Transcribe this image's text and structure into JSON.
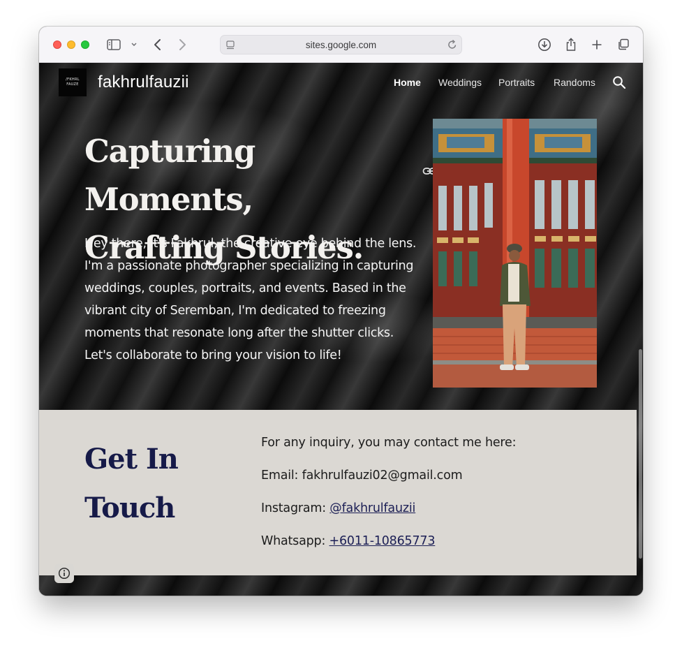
{
  "browser": {
    "url": "sites.google.com"
  },
  "site": {
    "logo_lines": [
      "/FKHRL",
      "FAUZE"
    ],
    "title": "fakhrulfauzii",
    "nav": [
      {
        "label": "Home",
        "active": true
      },
      {
        "label": "Weddings",
        "active": false
      },
      {
        "label": "Portraits",
        "active": false
      },
      {
        "label": "Randoms",
        "active": false
      }
    ]
  },
  "hero": {
    "title_line1": "Capturing Moments,",
    "title_line2": "Crafting Stories.",
    "body": "Hey there, it's Fakhrul, the creative eye behind the lens. I'm a passionate photographer specializing in capturing weddings, couples, portraits, and events. Based in the vibrant city of Seremban, I'm dedicated to freezing moments that resonate long after the shutter clicks. Let's collaborate to bring your vision to life!"
  },
  "contact": {
    "title_line1": "Get In",
    "title_line2": "Touch",
    "intro": "For any inquiry, you may contact me here:",
    "email_label": "Email: ",
    "email": "fakhrulfauzi02@gmail.com",
    "instagram_label": "Instagram: ",
    "instagram": "@fakhrulfauzii",
    "whatsapp_label": "Whatsapp: ",
    "whatsapp": "+6011-10865773"
  },
  "colors": {
    "contact_bg": "#dbd8d3",
    "heading_navy": "#161a48",
    "link_navy": "#1c1f55"
  }
}
